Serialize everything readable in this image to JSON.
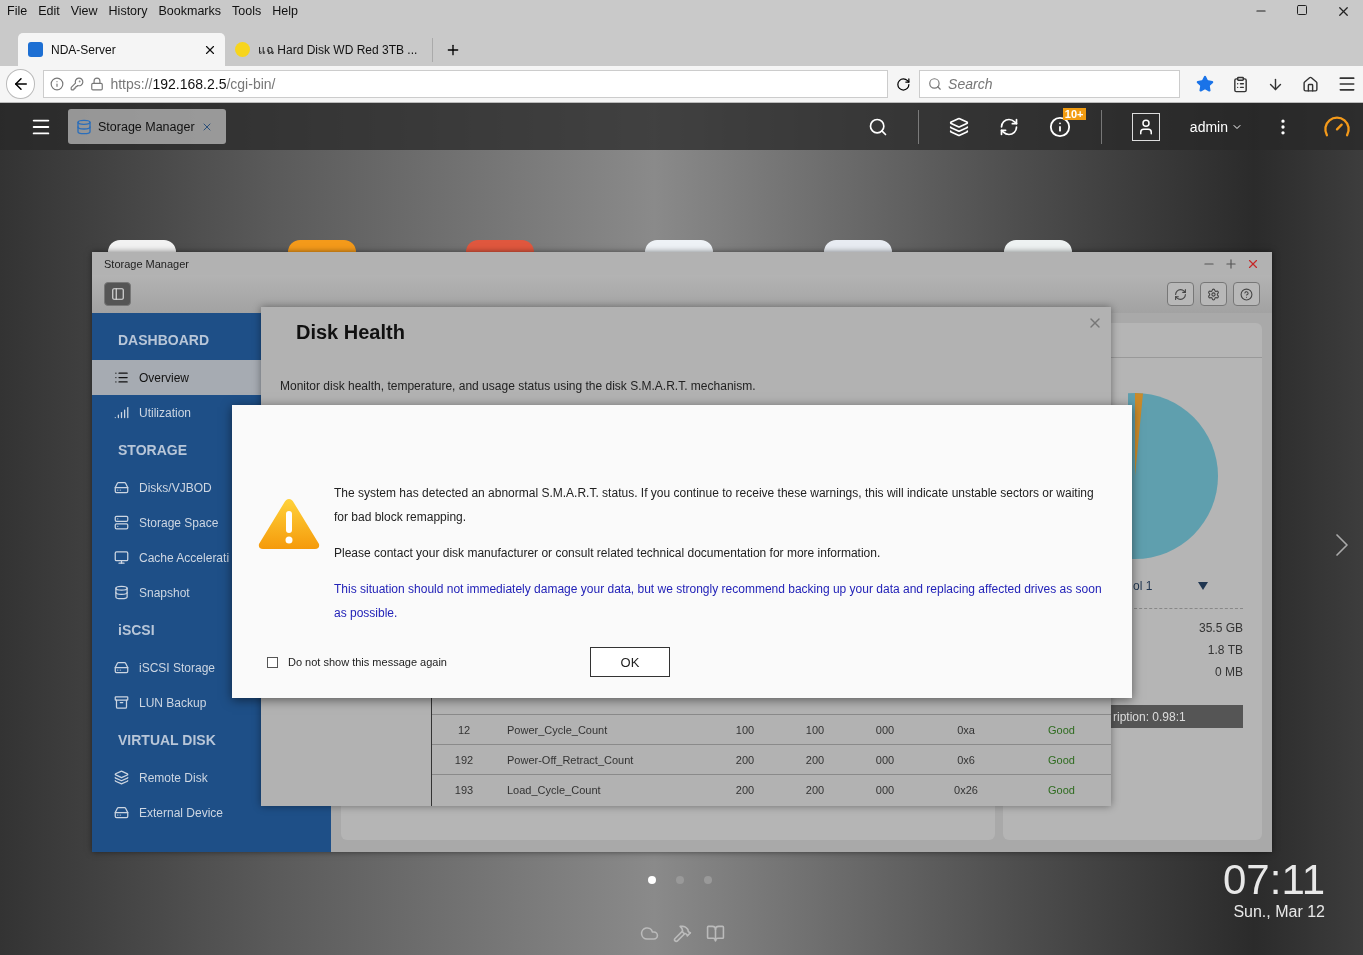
{
  "browser": {
    "menu": [
      "File",
      "Edit",
      "View",
      "History",
      "Bookmarks",
      "Tools",
      "Help"
    ],
    "tabs": [
      {
        "title": "NDA-Server",
        "selected": true
      },
      {
        "title": "แฉ Hard Disk WD Red 3TB ...",
        "selected": false
      }
    ],
    "url": {
      "scheme": "https://",
      "host": "192.168.2.5",
      "path": "/cgi-bin/"
    },
    "search_placeholder": "Search"
  },
  "topbar": {
    "app_tab": "Storage Manager",
    "notification_badge": "10+",
    "user": "admin"
  },
  "window": {
    "title": "Storage Manager"
  },
  "sidebar": [
    {
      "heading": "DASHBOARD",
      "items": [
        {
          "label": "Overview",
          "selected": true
        },
        {
          "label": "Utilization",
          "selected": false
        }
      ]
    },
    {
      "heading": "STORAGE",
      "items": [
        {
          "label": "Disks/VJBOD",
          "selected": false
        },
        {
          "label": "Storage Space",
          "selected": false
        },
        {
          "label": "Cache Accelerati",
          "selected": false
        },
        {
          "label": "Snapshot",
          "selected": false
        }
      ]
    },
    {
      "heading": "iSCSI",
      "items": [
        {
          "label": "iSCSI Storage",
          "selected": false
        },
        {
          "label": "LUN Backup",
          "selected": false
        }
      ]
    },
    {
      "heading": "VIRTUAL DISK",
      "items": [
        {
          "label": "Remote Disk",
          "selected": false
        },
        {
          "label": "External Device",
          "selected": false
        }
      ]
    }
  ],
  "overview_panel": {
    "pool": "ol 1",
    "values": [
      "35.5 GB",
      "1.8 TB",
      "0 MB"
    ],
    "ratio": "ription: 0.98:1"
  },
  "disk_health": {
    "title": "Disk Health",
    "description": "Monitor disk health, temperature, and usage status using the disk S.M.A.R.T. mechanism.",
    "rows": [
      [
        "12",
        "Power_Cycle_Count",
        "100",
        "100",
        "000",
        "0xa",
        "Good"
      ],
      [
        "192",
        "Power-Off_Retract_Count",
        "200",
        "200",
        "000",
        "0x6",
        "Good"
      ],
      [
        "193",
        "Load_Cycle_Count",
        "200",
        "200",
        "000",
        "0x26",
        "Good"
      ]
    ]
  },
  "alert": {
    "paragraphs": [
      "The system has detected an abnormal S.M.A.R.T. status. If you continue to receive these warnings, this will indicate unstable sectors or waiting for bad block remapping.",
      "Please contact your disk manufacturer or consult related technical documentation for more information."
    ],
    "note": "This situation should not immediately damage your data, but we strongly recommend backing up your data and replacing affected drives as soon as possible.",
    "checkbox": {
      "label": "Do not show this message again",
      "checked": false
    },
    "button": "OK"
  },
  "desktop": {
    "pages": [
      {
        "selected": true
      },
      {
        "selected": false
      },
      {
        "selected": false
      }
    ],
    "time": "07:11",
    "date": "Sun., Mar 12"
  }
}
